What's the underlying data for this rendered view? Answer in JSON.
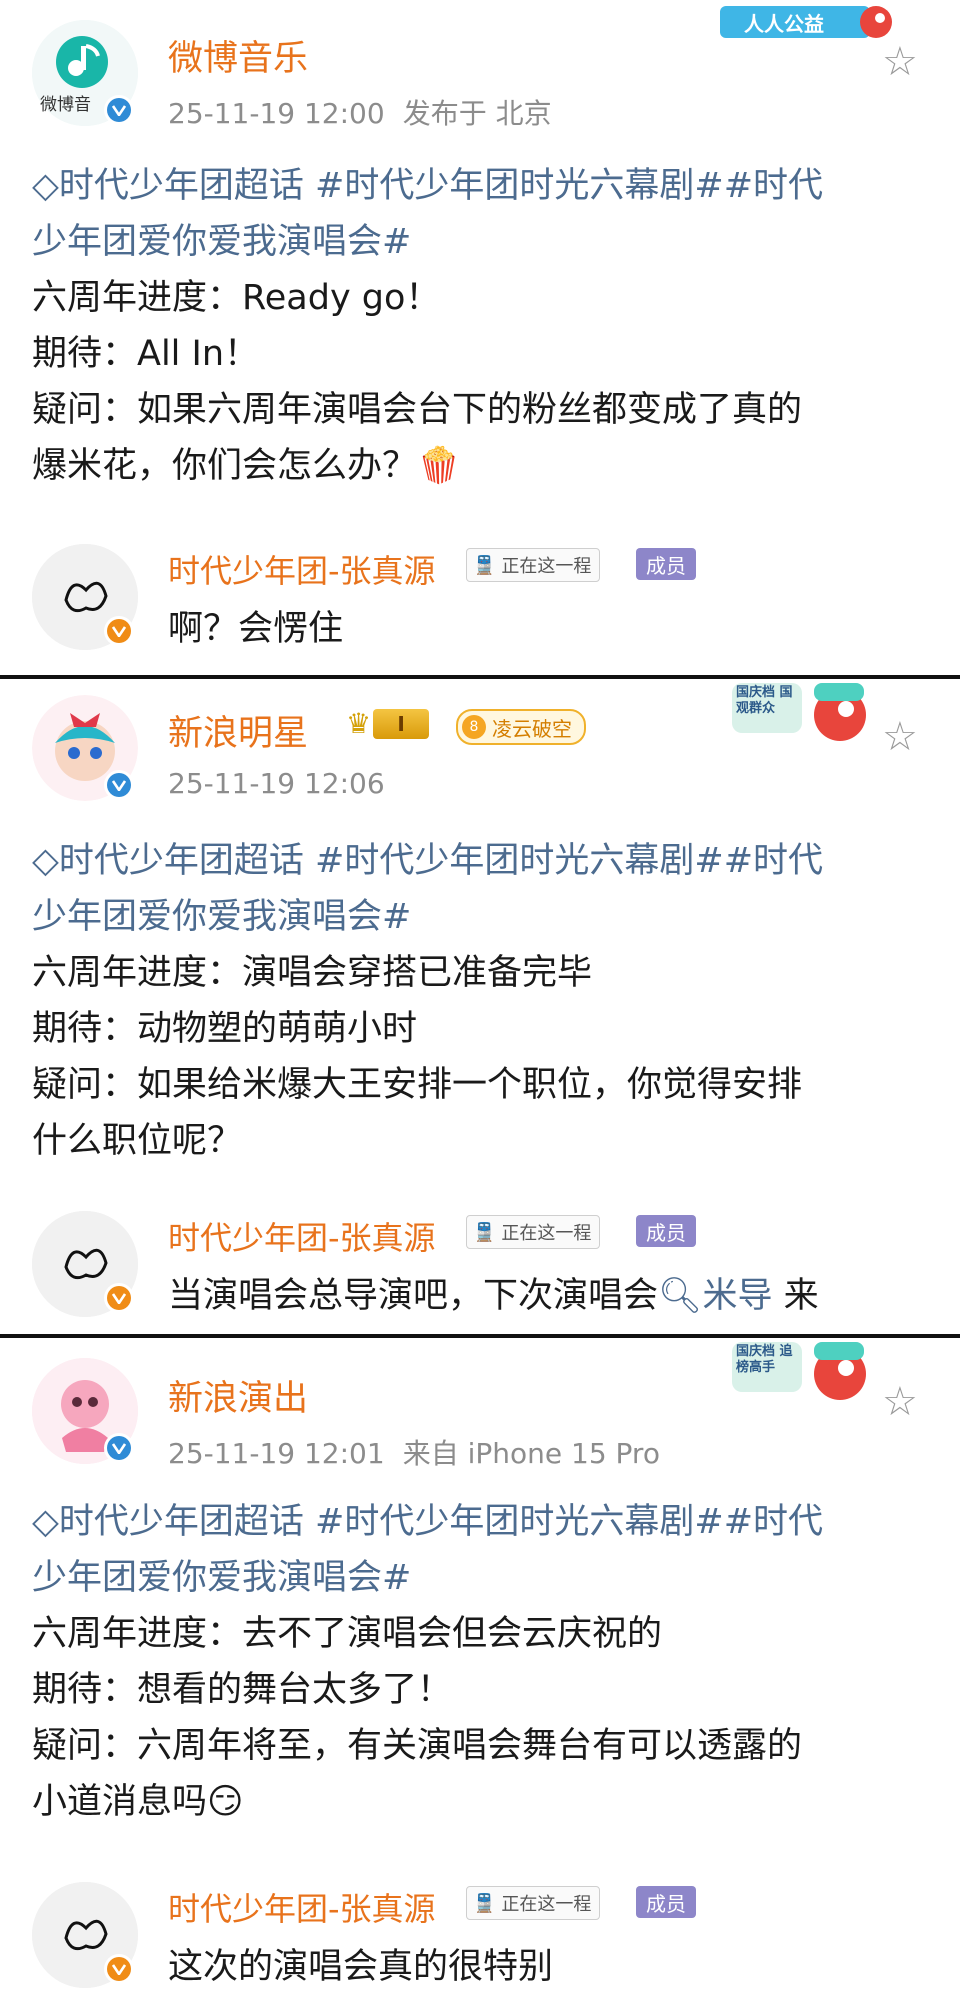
{
  "posts": [
    {
      "author": "微博音乐",
      "avatar_text": "微博音",
      "time": "25-11-19 12:00",
      "source": "发布于 北京",
      "corner_badge": "人人公益",
      "topic_line1": "时代少年团超话 #时代少年团时光六幕剧##时代",
      "topic_line2": "少年团爱你爱我演唱会#",
      "lines": [
        "六周年进度：Ready go！",
        "期待：All In！",
        "疑问：如果六周年演唱会台下的粉丝都变成了真的",
        "爆米花，你们会怎么办？🍿"
      ],
      "reply": {
        "name": "时代少年团-张真源",
        "tag": "正在这一程",
        "member": "成员",
        "text": "啊？会愣住"
      }
    },
    {
      "author": "新浪明星",
      "level": "I",
      "level_num": "8",
      "honor": "凌云破空",
      "time": "25-11-19 12:06",
      "source": "",
      "corner_badge": "国庆档 国观群众",
      "topic_line1": "时代少年团超话 #时代少年团时光六幕剧##时代",
      "topic_line2": "少年团爱你爱我演唱会#",
      "lines": [
        "六周年进度：演唱会穿搭已准备完毕",
        "期待：动物塑的萌萌小时",
        "疑问：如果给米爆大王安排一个职位，你觉得安排",
        "什么职位呢？"
      ],
      "reply": {
        "name": "时代少年团-张真源",
        "tag": "正在这一程",
        "member": "成员",
        "text_a": "当演唱会总导演吧，下次演唱会",
        "search_word": "米导",
        "text_b": " 来"
      }
    },
    {
      "author": "新浪演出",
      "time": "25-11-19 12:01",
      "source": "来自 iPhone 15 Pro",
      "corner_badge": "国庆档 追榜高手",
      "topic_line1": "时代少年团超话 #时代少年团时光六幕剧##时代",
      "topic_line2": "少年团爱你爱我演唱会#",
      "lines": [
        "六周年进度：去不了演唱会但会云庆祝的",
        "期待：想看的舞台太多了！",
        "疑问：六周年将至，有关演唱会舞台有可以透露的",
        "小道消息吗😏"
      ],
      "reply": {
        "name": "时代少年团-张真源",
        "tag": "正在这一程",
        "member": "成员",
        "text": "这次的演唱会真的很特别"
      }
    }
  ],
  "colors": {
    "name": "#e8731c",
    "topic": "#4c6b8f",
    "meta": "#8c8c8c",
    "member": "#8d86c9"
  },
  "icons": [
    "supertopic-diamond-icon",
    "star-outline-icon",
    "verified-v-icon",
    "train-icon",
    "search-icon",
    "crown-icon"
  ]
}
